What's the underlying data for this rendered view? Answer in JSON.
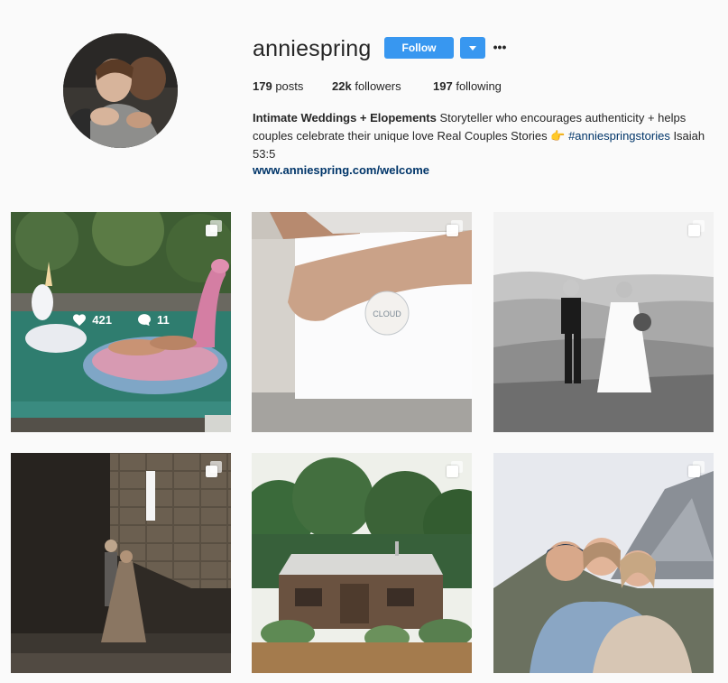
{
  "profile": {
    "username": "anniespring",
    "follow_label": "Follow",
    "more_label": "•••",
    "stats": {
      "posts_count": "179",
      "posts_label": "posts",
      "followers_count": "22k",
      "followers_label": "followers",
      "following_count": "197",
      "following_label": "following"
    },
    "bio": {
      "name": "Intimate Weddings + Elopements",
      "text": "Storyteller who encourages authenticity + helps couples celebrate their unique love Real Couples Stories",
      "emoji": "👉",
      "hashtag": "#anniespringstories",
      "verse": "Isaiah 53:5",
      "link": "www.anniespring.com/welcome"
    }
  },
  "posts": [
    {
      "likes": "421",
      "comments": "11",
      "icon": "multiple-photos-icon"
    },
    {
      "icon": "multiple-photos-icon"
    },
    {
      "icon": "multiple-photos-icon"
    },
    {
      "icon": "multiple-photos-icon"
    },
    {
      "icon": "multiple-photos-icon"
    },
    {
      "icon": "multiple-photos-icon"
    }
  ],
  "colors": {
    "accent": "#3897f0",
    "link": "#003569",
    "background": "#fafafa"
  }
}
